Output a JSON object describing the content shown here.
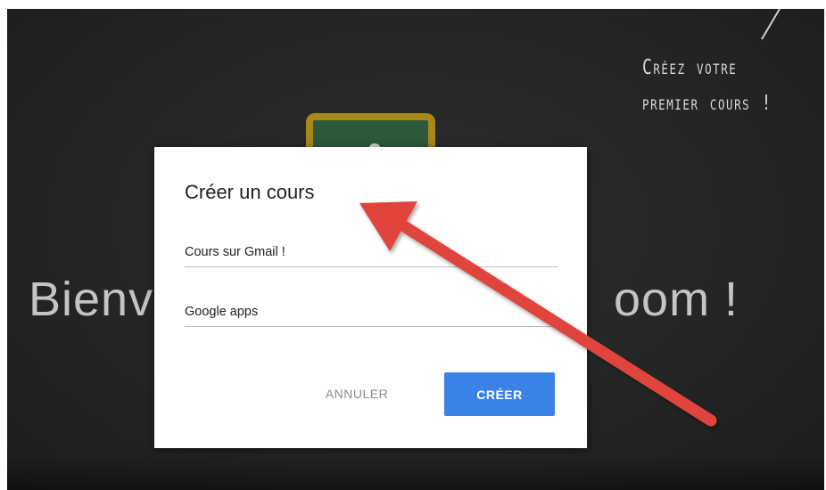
{
  "background": {
    "welcome_text_start": "Bienv",
    "welcome_text_end": "oom !",
    "chalk_note": "Créez votre\npremier cours !"
  },
  "dialog": {
    "title": "Créer un cours",
    "fields": [
      {
        "value": "Cours sur Gmail !"
      },
      {
        "value": "Google apps"
      }
    ],
    "cancel_label": "ANNULER",
    "create_label": "CRÉER"
  },
  "colors": {
    "accent": "#3b82e6",
    "annotation_arrow": "#e0443c",
    "background": "#242625"
  }
}
